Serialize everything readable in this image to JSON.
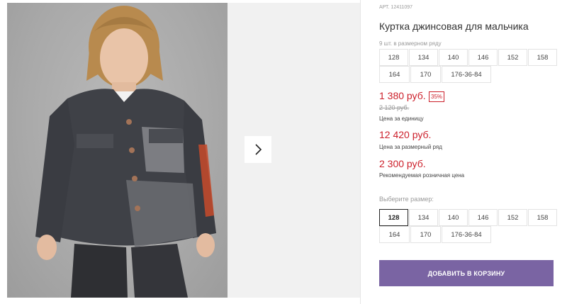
{
  "gallery": {
    "image_alt": "Boy in denim jacket",
    "next_icon": "chevron-right-icon"
  },
  "product": {
    "article_label": "АРТ.",
    "article": "12411097",
    "title": "Куртка джинсовая для мальчика",
    "pack_info": "9 шт. в размерном ряду"
  },
  "pack_sizes": [
    [
      "128",
      "134",
      "140",
      "146",
      "152",
      "158"
    ],
    [
      "164",
      "170",
      "176-36-84"
    ]
  ],
  "prices": {
    "unit_price": "1 380 руб.",
    "discount": "35%",
    "old_price": "2 120 руб.",
    "unit_label": "Цена за единицу",
    "series_price": "12 420 руб.",
    "series_label": "Цена за размерный ряд",
    "rrp_price": "2 300 руб.",
    "rrp_label": "Рекомендуемая розничная цена"
  },
  "size_select": {
    "label": "Выберите размер:",
    "selected": "128",
    "rows": [
      [
        "128",
        "134",
        "140",
        "146",
        "152",
        "158"
      ],
      [
        "164",
        "170",
        "176-36-84"
      ]
    ]
  },
  "cart": {
    "button_label": "ДОБАВИТЬ В КОРЗИНУ"
  },
  "colors": {
    "price_red": "#cc1f2a",
    "button_purple": "#7a64a3"
  }
}
